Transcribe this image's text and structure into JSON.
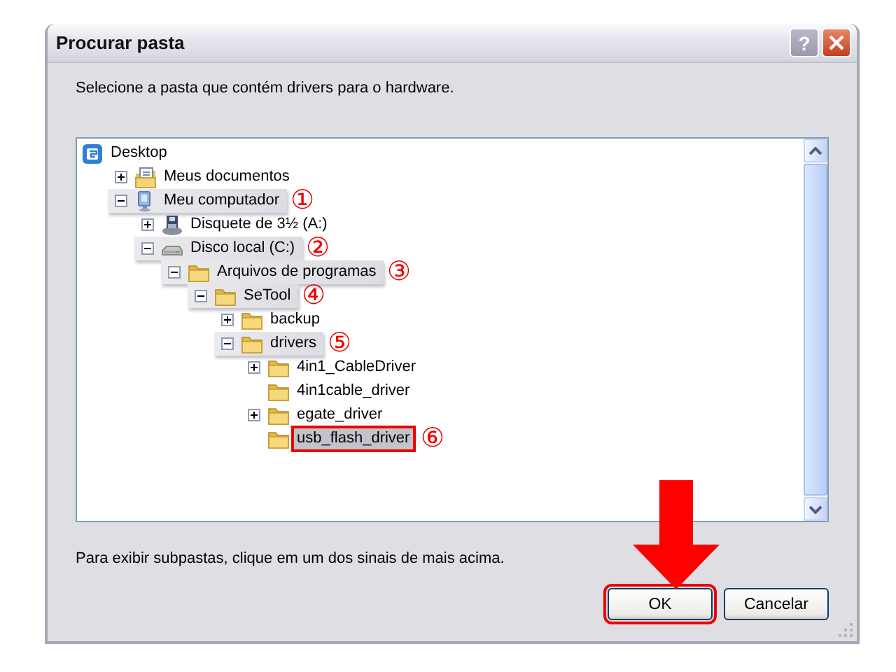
{
  "window": {
    "title": "Procurar pasta",
    "help_button": "?"
  },
  "instruction": "Selecione a pasta que contém drivers para o hardware.",
  "tree": [
    {
      "label": "Desktop",
      "kind": "desktop",
      "children": [
        {
          "label": "Meus documentos",
          "kind": "documents",
          "expanded": false
        },
        {
          "label": "Meu computador",
          "kind": "computer",
          "expanded": true,
          "highlighted": true,
          "marker": "①",
          "children": [
            {
              "label": "Disquete de 3½ (A:)",
              "kind": "floppy",
              "expanded": false
            },
            {
              "label": "Disco local (C:)",
              "kind": "disk",
              "expanded": true,
              "highlighted": true,
              "marker": "②",
              "children": [
                {
                  "label": "Arquivos de programas",
                  "kind": "folder",
                  "expanded": true,
                  "highlighted": true,
                  "marker": "③",
                  "children": [
                    {
                      "label": "SeTool",
                      "kind": "folder",
                      "expanded": true,
                      "highlighted": true,
                      "marker": "④",
                      "children": [
                        {
                          "label": "backup",
                          "kind": "folder",
                          "expanded": false
                        },
                        {
                          "label": "drivers",
                          "kind": "folder",
                          "expanded": true,
                          "highlighted": true,
                          "marker": "⑤",
                          "children": [
                            {
                              "label": "4in1_CableDriver",
                              "kind": "folder",
                              "expanded": false
                            },
                            {
                              "label": "4in1cable_driver",
                              "kind": "folder"
                            },
                            {
                              "label": "egate_driver",
                              "kind": "folder",
                              "expanded": false
                            },
                            {
                              "label": "usb_flash_driver",
                              "kind": "folder",
                              "selected": true,
                              "marker": "⑥"
                            }
                          ]
                        }
                      ]
                    }
                  ]
                }
              ]
            }
          ]
        }
      ]
    }
  ],
  "hint": "Para exibir subpastas, clique em um dos sinais de mais acima.",
  "buttons": [
    {
      "label": "OK",
      "annotated": true
    },
    {
      "label": "Cancelar",
      "annotated": false
    }
  ]
}
